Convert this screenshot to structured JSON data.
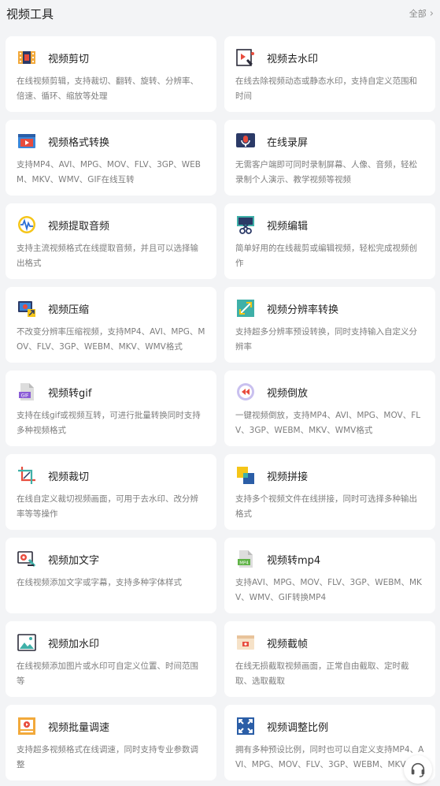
{
  "header": {
    "title": "视频工具",
    "more_label": "全部",
    "more_icon": "chevron-right-icon"
  },
  "tools": [
    {
      "name": "video-cut",
      "title": "视频剪切",
      "desc": "在线视频剪辑，支持裁切、翻转、旋转、分辨率、倍速、循环、缩放等处理",
      "icon": "film-strip-icon"
    },
    {
      "name": "video-watermark-remove",
      "title": "视频去水印",
      "desc": "在线去除视频动态或静态水印，支持自定义范围和时间",
      "icon": "eraser-video-icon"
    },
    {
      "name": "video-format-convert",
      "title": "视频格式转换",
      "desc": "支持MP4、AVI、MPG、MOV、FLV、3GP、WEBM、MKV、WMV、GIF在线互转",
      "icon": "video-window-icon"
    },
    {
      "name": "screen-record",
      "title": "在线录屏",
      "desc": "无需客户端即可同时录制屏幕、人像、音频，轻松录制个人演示、教学视频等视频",
      "icon": "microphone-icon"
    },
    {
      "name": "audio-extract",
      "title": "视频提取音频",
      "desc": "支持主流视频格式在线提取音频，并且可以选择输出格式",
      "icon": "audio-wave-icon"
    },
    {
      "name": "video-edit",
      "title": "视频编辑",
      "desc": "简单好用的在线裁剪或编辑视频，轻松完成视频创作",
      "icon": "scissors-film-icon"
    },
    {
      "name": "video-compress",
      "title": "视频压缩",
      "desc": "不改变分辨率压缩视频，支持MP4、AVI、MPG、MOV、FLV、3GP、WEBM、MKV、WMV格式",
      "icon": "compress-monitor-icon"
    },
    {
      "name": "resolution-convert",
      "title": "视频分辨率转换",
      "desc": "支持超多分辨率预设转换，同时支持输入自定义分辨率",
      "icon": "resize-arrows-icon"
    },
    {
      "name": "video-to-gif",
      "title": "视频转gif",
      "desc": "支持在线gif或视频互转，可进行批量转换同时支持多种视频格式",
      "icon": "gif-file-icon"
    },
    {
      "name": "video-reverse",
      "title": "视频倒放",
      "desc": "一键视频倒放，支持MP4、AVI、MPG、MOV、FLV、3GP、WEBM、MKV、WMV格式",
      "icon": "rewind-icon"
    },
    {
      "name": "video-crop",
      "title": "视频裁切",
      "desc": "在线自定义裁切视频画面，可用于去水印、改分辨率等等操作",
      "icon": "crop-icon"
    },
    {
      "name": "video-merge",
      "title": "视频拼接",
      "desc": "支持多个视频文件在线拼接，同时可选择多种输出格式",
      "icon": "merge-squares-icon"
    },
    {
      "name": "video-add-text",
      "title": "视频加文字",
      "desc": "在线视频添加文字或字幕，支持多种字体样式",
      "icon": "text-pen-icon"
    },
    {
      "name": "video-to-mp4",
      "title": "视频转mp4",
      "desc": "支持AVI、MPG、MOV、FLV、3GP、WEBM、MKV、WMV、GIF转换MP4",
      "icon": "mp4-file-icon"
    },
    {
      "name": "video-add-watermark",
      "title": "视频加水印",
      "desc": "在线视频添加图片或水印可自定义位置、时间范围等",
      "icon": "image-landscape-icon"
    },
    {
      "name": "video-frame-capture",
      "title": "视频截帧",
      "desc": "在线无损截取视频画面，正常自由截取、定时截取、选取截取",
      "icon": "frame-window-icon"
    },
    {
      "name": "batch-speed",
      "title": "视频批量调速",
      "desc": "支持超多视频格式在线调速，同时支持专业参数调整",
      "icon": "speed-play-icon"
    },
    {
      "name": "aspect-ratio",
      "title": "视频调整比例",
      "desc": "拥有多种预设比例，同时也可以自定义支持MP4、AVI、MPG、MOV、FLV、3GP、WEBM、MKV",
      "icon": "expand-arrows-icon"
    }
  ],
  "float_button": {
    "icon": "headset-icon"
  }
}
